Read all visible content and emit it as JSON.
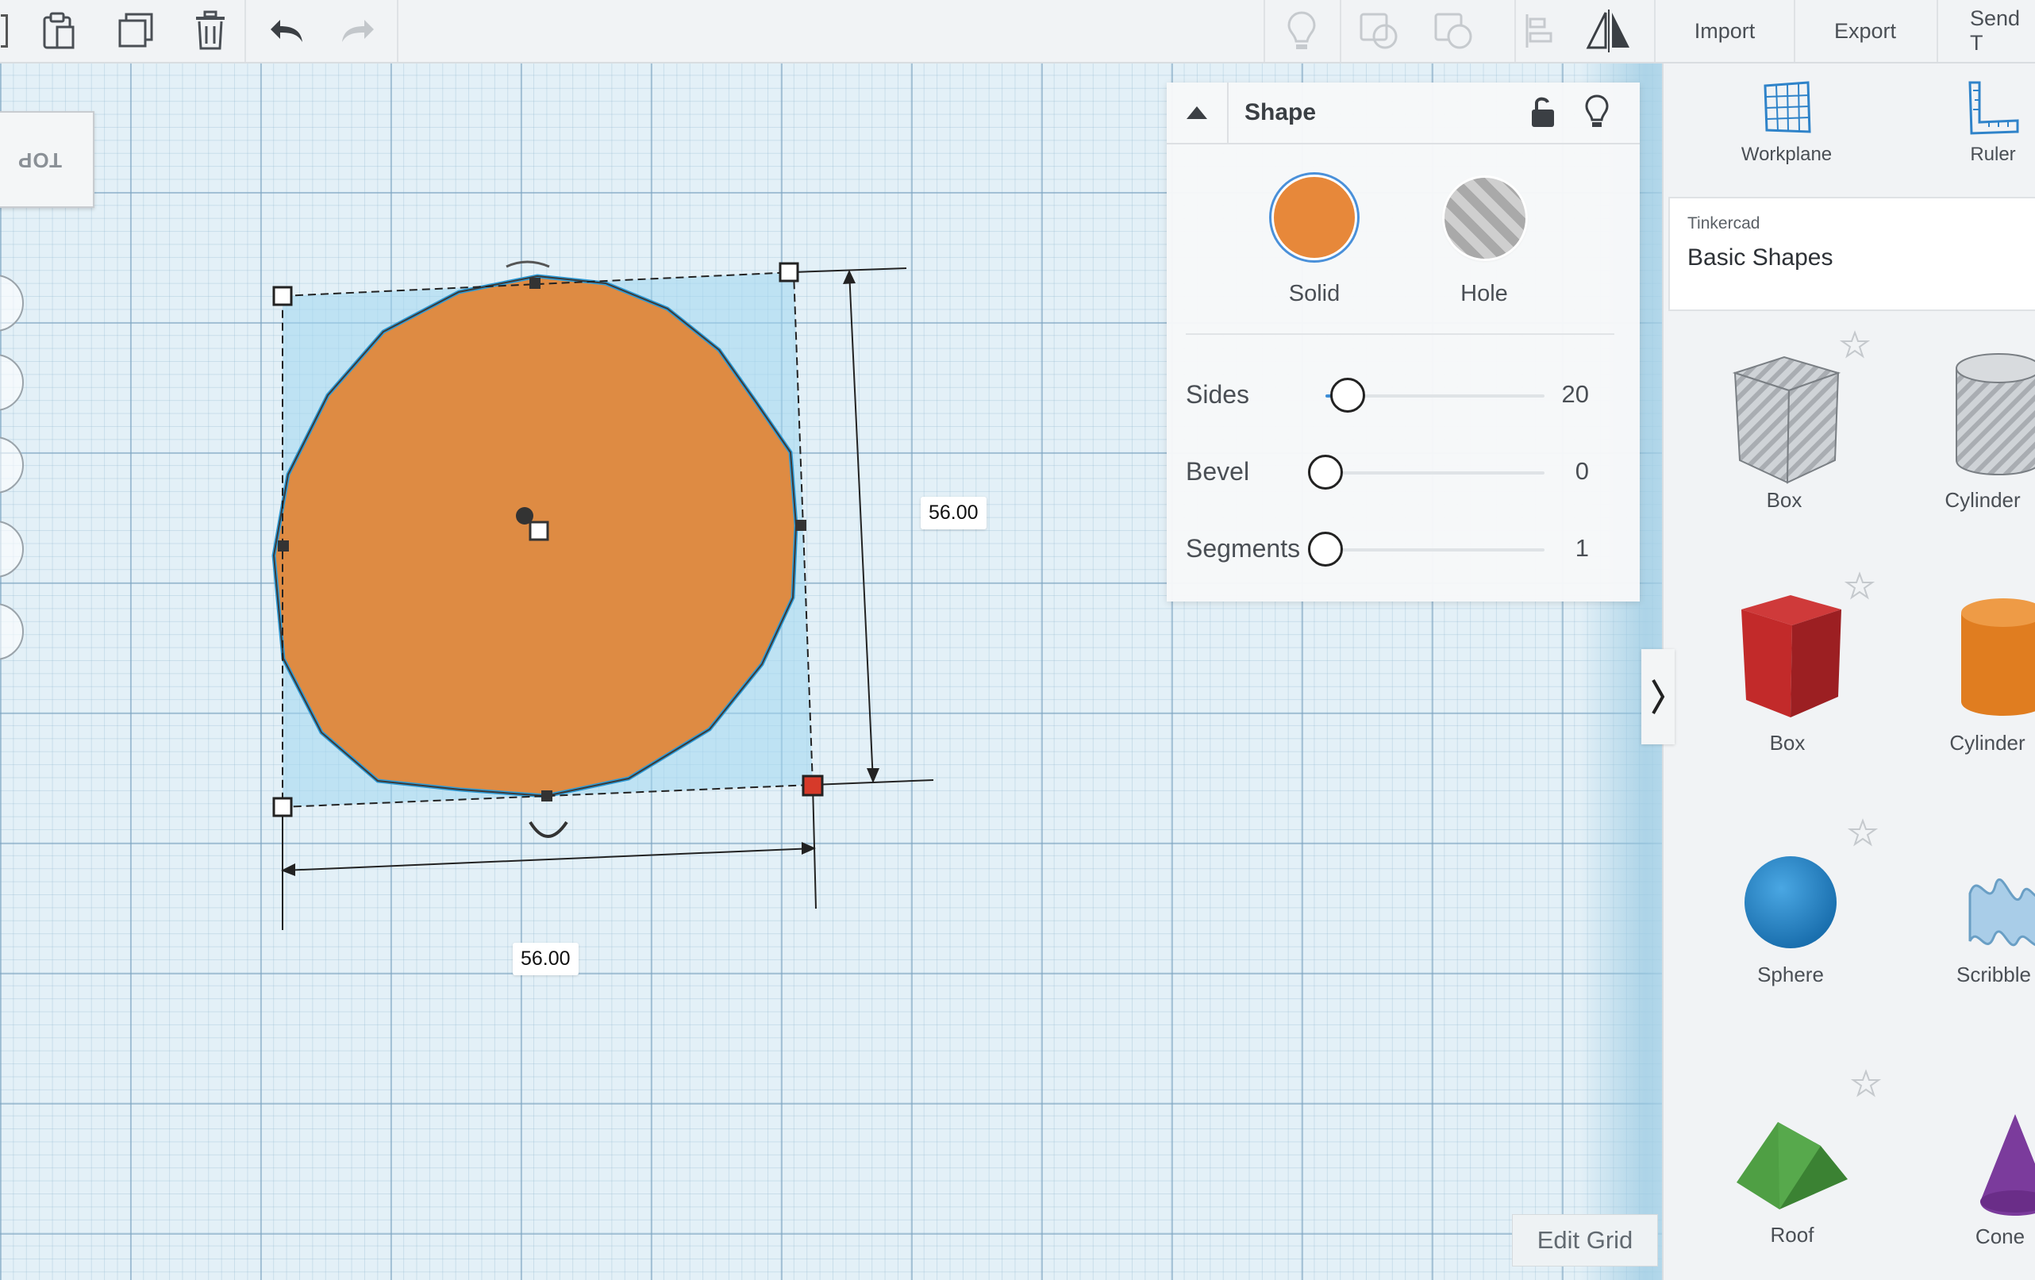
{
  "toolbar": {
    "import_label": "Import",
    "export_label": "Export",
    "send_label": "Send T"
  },
  "viewcube": {
    "face_label": "TOP"
  },
  "dimensions": {
    "height": "56.00",
    "width": "56.00"
  },
  "inspector": {
    "title": "Shape",
    "solid_label": "Solid",
    "hole_label": "Hole",
    "solid_color": "#e7883a",
    "properties": [
      {
        "label": "Sides",
        "value": "20",
        "level": 0.1
      },
      {
        "label": "Bevel",
        "value": "0",
        "level": 0
      },
      {
        "label": "Segments",
        "value": "1",
        "level": 0
      }
    ]
  },
  "sidebar": {
    "workplane_label": "Workplane",
    "ruler_label": "Ruler",
    "library_source": "Tinkercad",
    "library_name": "Basic Shapes",
    "shapes": [
      {
        "label": "Box",
        "icon": "box-hole-icon"
      },
      {
        "label": "Cylinder",
        "icon": "cylinder-hole-icon"
      },
      {
        "label": "Box",
        "icon": "box-red-icon"
      },
      {
        "label": "Cylinder",
        "icon": "cylinder-orange-icon"
      },
      {
        "label": "Sphere",
        "icon": "sphere-blue-icon"
      },
      {
        "label": "Scribble",
        "icon": "scribble-icon"
      },
      {
        "label": "Roof",
        "icon": "roof-green-icon"
      },
      {
        "label": "Cone",
        "icon": "cone-purple-icon"
      }
    ]
  },
  "workplane": {
    "edit_grid_label": "Edit Grid"
  },
  "colors": {
    "accent": "#3f8ed6",
    "shape": "#e0883a",
    "selection": "#2e9bd6"
  }
}
